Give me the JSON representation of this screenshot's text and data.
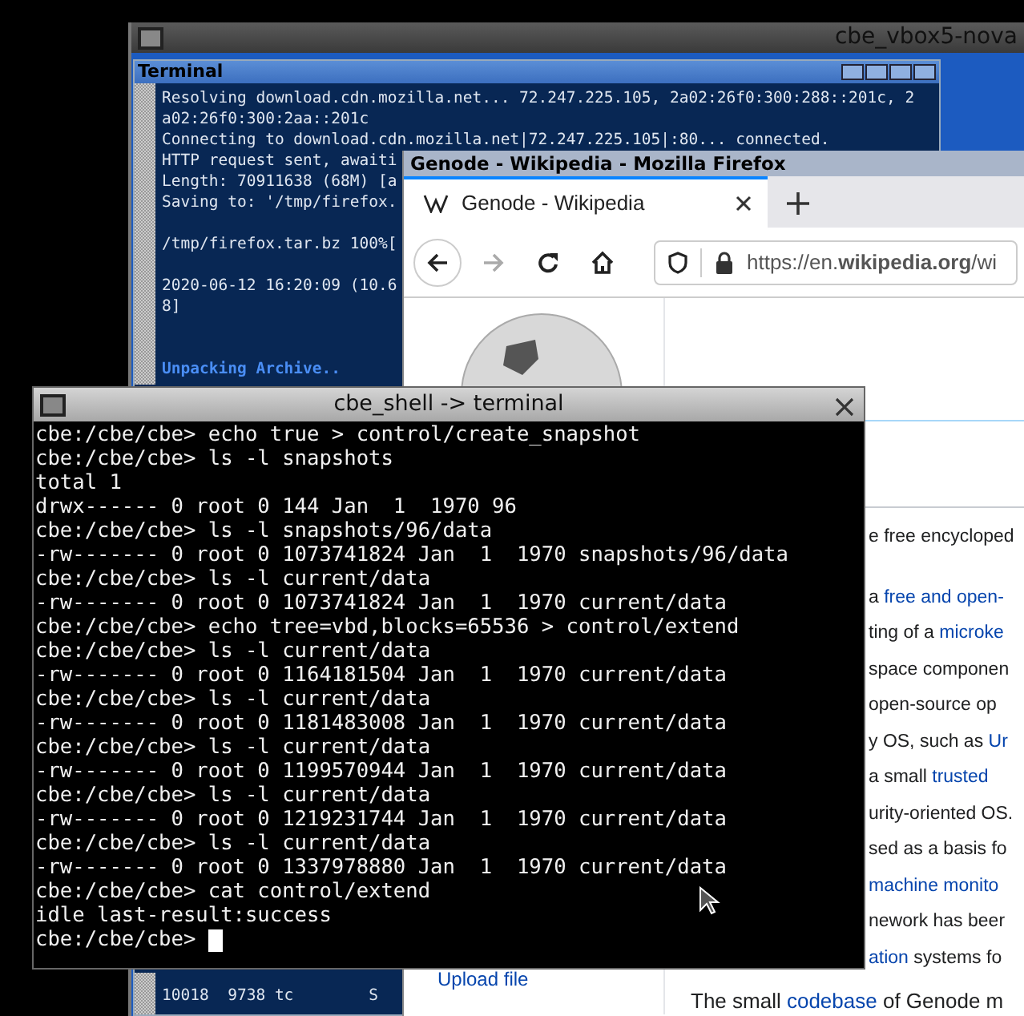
{
  "vm_window": {
    "title": "cbe_vbox5-nova"
  },
  "terminal": {
    "title": "Terminal",
    "blocks": [
      {
        "kind": "output",
        "lines": [
          "Resolving download.cdn.mozilla.net... 72.247.225.105, 2a02:26f0:300:288::201c, 2",
          "a02:26f0:300:2aa::201c",
          "Connecting to download.cdn.mozilla.net|72.247.225.105|:80... connected.",
          "HTTP request sent, awaiti",
          "Length: 70911638 (68M) [a",
          "Saving to: '/tmp/firefox."
        ]
      },
      {
        "kind": "output",
        "lines": [
          "/tmp/firefox.tar.bz 100%["
        ]
      },
      {
        "kind": "output",
        "lines": [
          "2020-06-12 16:20:09 (10.6",
          "8]"
        ]
      },
      {
        "kind": "status",
        "lines": [
          "Unpacking Archive.."
        ]
      }
    ],
    "lower_lines": [
      "10018  9738 tc        S"
    ]
  },
  "firefox": {
    "title": "Genode - Wikipedia - Mozilla Firefox",
    "tabs": [
      {
        "label": "Genode - Wikipedia",
        "selected": true
      }
    ],
    "url": "https://en.**wikipedia.org**/wi",
    "article": [
      {
        "lines": [
          [
            {
              "kind": "plain",
              "text": "e free encycloped"
            }
          ]
        ]
      },
      {
        "lines": [
          [
            {
              "kind": "plain",
              "text": "a "
            },
            {
              "kind": "link",
              "text": "free and open-"
            }
          ],
          [
            {
              "kind": "plain",
              "text": "ting of a "
            },
            {
              "kind": "link",
              "text": "microke"
            }
          ],
          [
            {
              "kind": "plain",
              "text": "space componen"
            }
          ],
          [
            {
              "kind": "plain",
              "text": "open-source op"
            }
          ],
          [
            {
              "kind": "plain",
              "text": "y OS, such as "
            },
            {
              "kind": "link",
              "text": "Ur"
            }
          ],
          [
            {
              "kind": "plain",
              "text": "a small "
            },
            {
              "kind": "link",
              "text": "trusted"
            }
          ],
          [
            {
              "kind": "plain",
              "text": "urity-oriented OS."
            }
          ]
        ]
      },
      {
        "lines": [
          [
            {
              "kind": "plain",
              "text": "sed as a basis fo"
            }
          ],
          [
            {
              "kind": "link",
              "text": "machine monito"
            }
          ],
          [
            {
              "kind": "plain",
              "text": "nework has beer"
            }
          ],
          [
            {
              "kind": "link",
              "text": "ation"
            },
            {
              "kind": "plain",
              "text": " systems fo"
            }
          ]
        ]
      }
    ],
    "sidebar_link": "Upload file",
    "bottom_line": [
      {
        "kind": "plain",
        "text": "The small "
      },
      {
        "kind": "link",
        "text": "codebase"
      },
      {
        "kind": "plain",
        "text": " of Genode m"
      }
    ]
  },
  "shell": {
    "title": "cbe_shell -> terminal",
    "lines": [
      "cbe:/cbe/cbe> echo true > control/create_snapshot",
      "cbe:/cbe/cbe> ls -l snapshots",
      "total 1",
      "drwx------ 0 root 0 144 Jan  1  1970 96",
      "cbe:/cbe/cbe> ls -l snapshots/96/data",
      "-rw------- 0 root 0 1073741824 Jan  1  1970 snapshots/96/data",
      "cbe:/cbe/cbe> ls -l current/data",
      "-rw------- 0 root 0 1073741824 Jan  1  1970 current/data",
      "cbe:/cbe/cbe> echo tree=vbd,blocks=65536 > control/extend",
      "cbe:/cbe/cbe> ls -l current/data",
      "-rw------- 0 root 0 1164181504 Jan  1  1970 current/data",
      "cbe:/cbe/cbe> ls -l current/data",
      "-rw------- 0 root 0 1181483008 Jan  1  1970 current/data",
      "cbe:/cbe/cbe> ls -l current/data",
      "-rw------- 0 root 0 1199570944 Jan  1  1970 current/data",
      "cbe:/cbe/cbe> ls -l current/data",
      "-rw------- 0 root 0 1219231744 Jan  1  1970 current/data",
      "cbe:/cbe/cbe> ls -l current/data",
      "-rw------- 0 root 0 1337978880 Jan  1  1970 current/data",
      "cbe:/cbe/cbe> cat control/extend",
      "idle last-result:success",
      "cbe:/cbe/cbe>"
    ]
  }
}
